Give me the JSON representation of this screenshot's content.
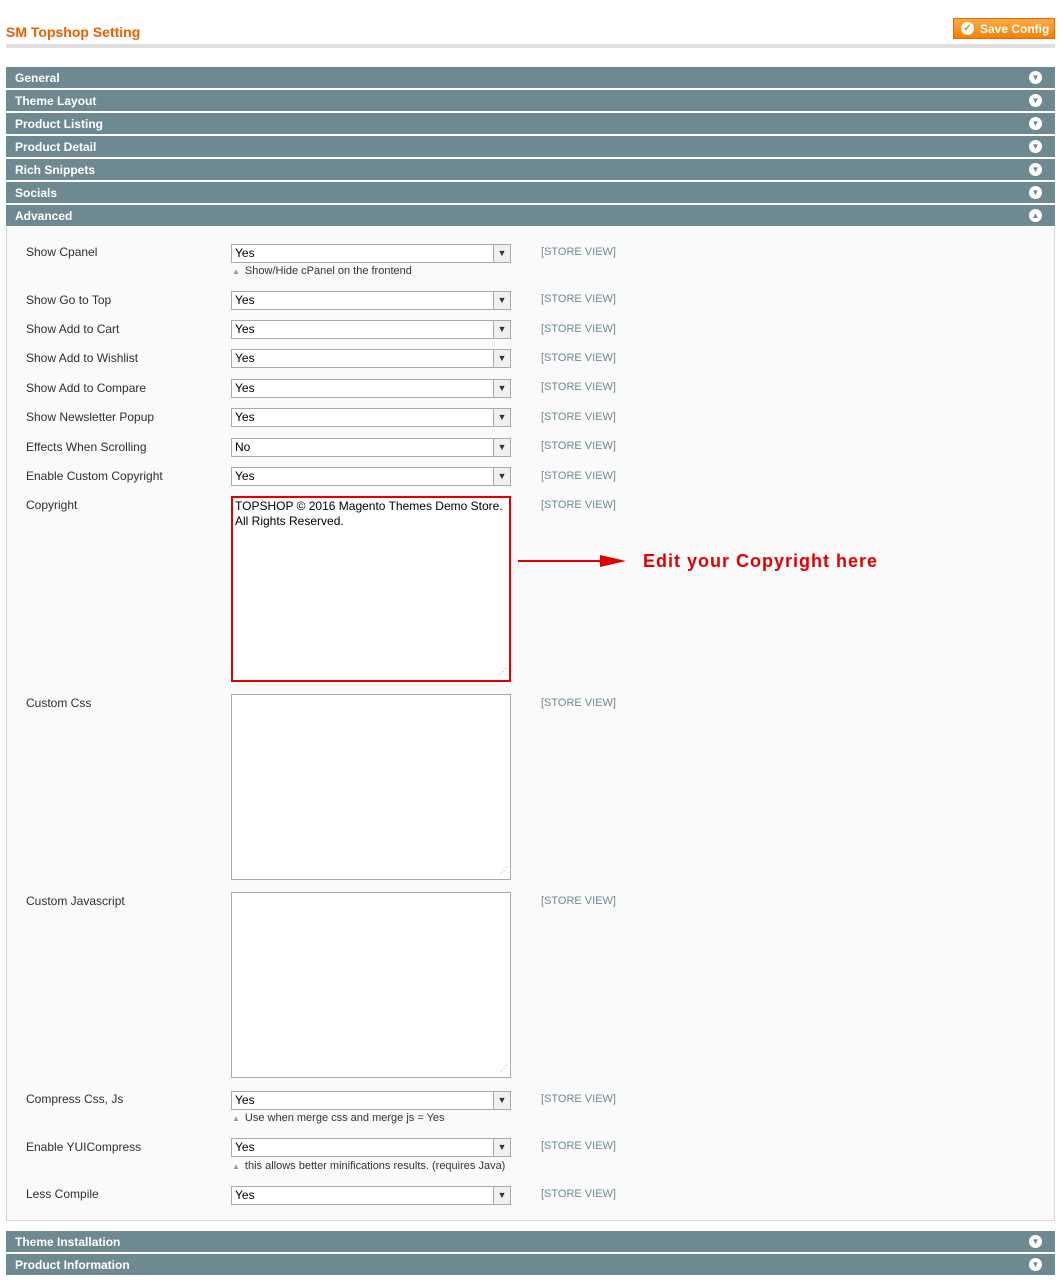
{
  "header": {
    "title": "SM Topshop Setting",
    "save_label": "Save Config"
  },
  "sections": {
    "general": "General",
    "theme_layout": "Theme Layout",
    "product_listing": "Product Listing",
    "product_detail": "Product Detail",
    "rich_snippets": "Rich Snippets",
    "socials": "Socials",
    "advanced": "Advanced",
    "theme_installation": "Theme Installation",
    "product_information": "Product Information"
  },
  "scope_label": "[STORE VIEW]",
  "fields": {
    "show_cpanel": {
      "label": "Show Cpanel",
      "value": "Yes",
      "note": "Show/Hide cPanel on the frontend"
    },
    "show_go_to_top": {
      "label": "Show Go to Top",
      "value": "Yes"
    },
    "show_add_to_cart": {
      "label": "Show Add to Cart",
      "value": "Yes"
    },
    "show_add_to_wishlist": {
      "label": "Show Add to Wishlist",
      "value": "Yes"
    },
    "show_add_to_compare": {
      "label": "Show Add to Compare",
      "value": "Yes"
    },
    "show_newsletter_popup": {
      "label": "Show Newsletter Popup",
      "value": "Yes"
    },
    "effects_when_scrolling": {
      "label": "Effects When Scrolling",
      "value": "No"
    },
    "enable_custom_copyright": {
      "label": "Enable Custom Copyright",
      "value": "Yes"
    },
    "copyright": {
      "label": "Copyright",
      "value": "TOPSHOP  ©  2016 Magento Themes Demo Store. All Rights Reserved."
    },
    "custom_css": {
      "label": "Custom Css",
      "value": ""
    },
    "custom_javascript": {
      "label": "Custom Javascript",
      "value": ""
    },
    "compress_css_js": {
      "label": "Compress Css, Js",
      "value": "Yes",
      "note": "Use when merge css and merge js = Yes"
    },
    "enable_yuicompress": {
      "label": "Enable YUICompress",
      "value": "Yes",
      "note": "this allows better minifications results. (requires Java)"
    },
    "less_compile": {
      "label": "Less Compile",
      "value": "Yes"
    }
  },
  "annotation": {
    "text": "Edit your Copyright here",
    "color": "#e10000"
  },
  "colors": {
    "accent": "#eb5e00",
    "section_bar": "#6f8992",
    "highlight": "#e10000"
  }
}
